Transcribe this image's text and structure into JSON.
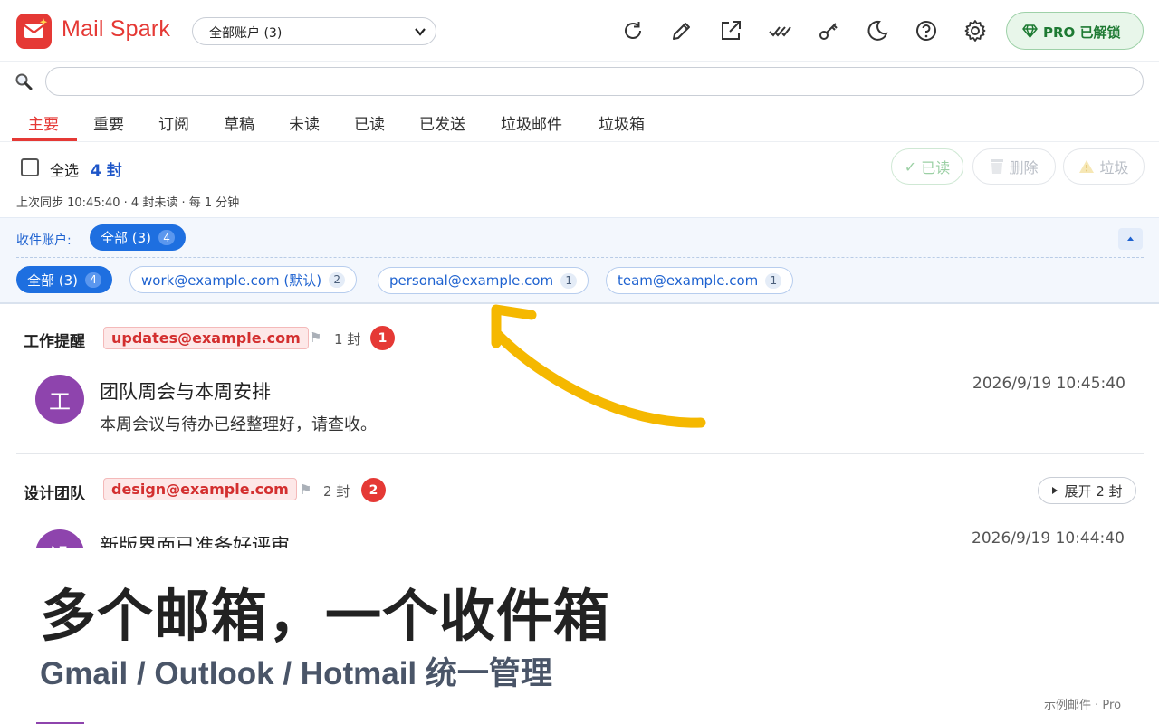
{
  "header": {
    "app_title": "Mail Spark",
    "account_select": "全部账户 (3)",
    "pro_label": "PRO 已解锁",
    "icons": [
      "refresh-icon",
      "edit-icon",
      "external-link-icon",
      "check-all-icon",
      "key-icon",
      "moon-icon",
      "help-icon",
      "gear-icon",
      "gem-icon"
    ]
  },
  "search": {
    "placeholder": "",
    "value": ""
  },
  "tabs": [
    "主要",
    "重要",
    "订阅",
    "草稿",
    "未读",
    "已读",
    "已发送",
    "垃圾邮件",
    "垃圾箱"
  ],
  "toolbar": {
    "select_all": "全选",
    "count": "4 封",
    "mark_read": "已读",
    "delete": "删除",
    "spam": "垃圾",
    "sync_status": "上次同步 10:45:40 · 4 封未读 · 每 1 分钟"
  },
  "accounts": {
    "label": "收件账户:",
    "current": {
      "label": "全部 (3)",
      "badge": "4"
    },
    "chips": [
      {
        "label": "全部 (3)",
        "badge": "4"
      },
      {
        "label": "work@example.com (默认)",
        "badge": "2"
      },
      {
        "label": "personal@example.com",
        "badge": "1"
      },
      {
        "label": "team@example.com",
        "badge": "1"
      }
    ]
  },
  "groups": [
    {
      "name": "工作提醒",
      "email": "updates@example.com",
      "count": "1 封",
      "badge": "1",
      "mail": {
        "avatar": "工",
        "subject": "团队周会与本周安排",
        "preview": "本周会议与待办已经整理好，请查收。",
        "time": "2026/9/19 10:45:40"
      }
    },
    {
      "name": "设计团队",
      "email": "design@example.com",
      "count": "2 封",
      "badge": "2",
      "expand": "展开 2 封",
      "mail": {
        "avatar": "设",
        "subject": "新版界面已准备好评审",
        "time": "2026/9/19 10:44:40"
      }
    }
  ],
  "promo": {
    "title": "多个邮箱，一个收件箱",
    "subtitle": "Gmail / Outlook / Hotmail 统一管理",
    "footer": "示例邮件 · Pro"
  },
  "colors": {
    "brand_red": "#e53935",
    "accent_blue": "#1e6fe0",
    "pro_green": "#1e7a33",
    "avatar_purple": "#8e44ad",
    "arrow_yellow": "#f5b800"
  }
}
